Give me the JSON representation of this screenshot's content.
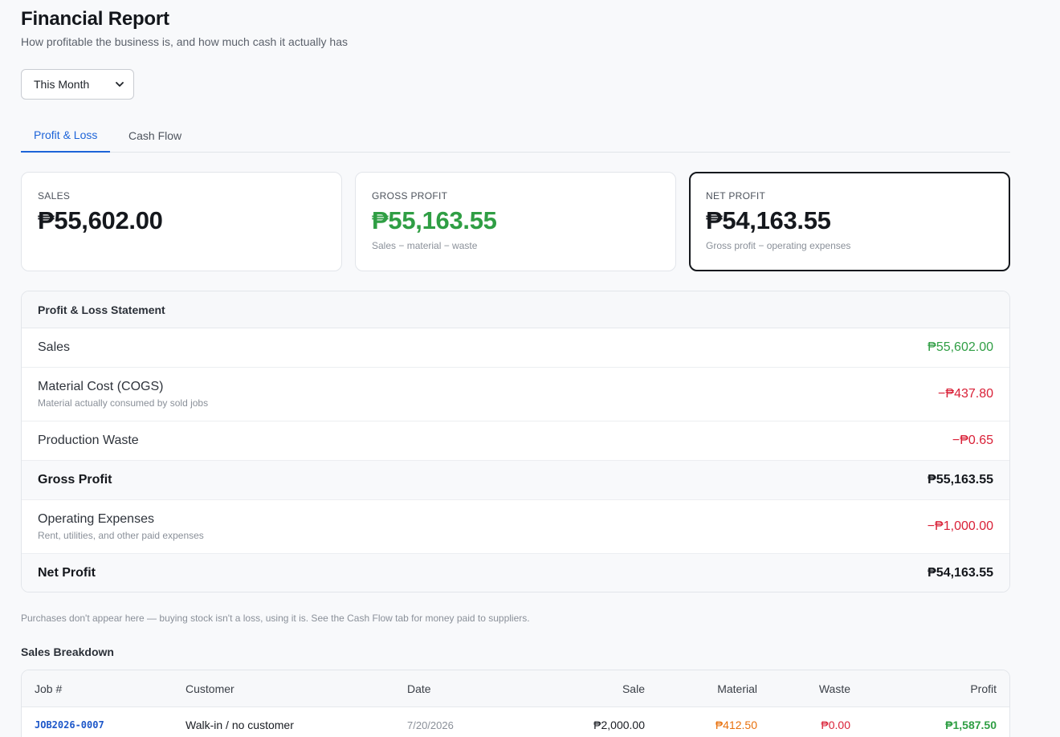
{
  "header": {
    "title": "Financial Report",
    "subtitle": "How profitable the business is, and how much cash it actually has"
  },
  "period_select": {
    "value": "This Month",
    "icon": "chevron-down-icon"
  },
  "tabs": [
    {
      "label": "Profit & Loss",
      "active": true
    },
    {
      "label": "Cash Flow",
      "active": false
    }
  ],
  "summary_cards": {
    "sales": {
      "label": "SALES",
      "value": "₱55,602.00"
    },
    "gross_profit": {
      "label": "GROSS PROFIT",
      "value": "₱55,163.55",
      "sub": "Sales − material − waste"
    },
    "net_profit": {
      "label": "NET PROFIT",
      "value": "₱54,163.55",
      "sub": "Gross profit − operating expenses"
    }
  },
  "statement": {
    "title": "Profit & Loss Statement",
    "rows": [
      {
        "label": "Sales",
        "amount": "₱55,602.00"
      },
      {
        "label": "Material Cost (COGS)",
        "note": "Material actually consumed by sold jobs",
        "amount": "−₱437.80"
      },
      {
        "label": "Production Waste",
        "amount": "−₱0.65"
      },
      {
        "label": "Gross Profit",
        "amount": "₱55,163.55"
      },
      {
        "label": "Operating Expenses",
        "note": "Rent, utilities, and other paid expenses",
        "amount": "−₱1,000.00"
      },
      {
        "label": "Net Profit",
        "amount": "₱54,163.55"
      }
    ]
  },
  "footnote": "Purchases don't appear here — buying stock isn't a loss, using it is. See the Cash Flow tab for money paid to suppliers.",
  "sales_breakdown": {
    "title": "Sales Breakdown",
    "columns": [
      "Job #",
      "Customer",
      "Date",
      "Sale",
      "Material",
      "Waste",
      "Profit"
    ],
    "rows": [
      {
        "job": "JOB2026-0007",
        "customer": "Walk-in / no customer",
        "date": "7/20/2026",
        "sale": "₱2,000.00",
        "material": "₱412.50",
        "waste": "₱0.00",
        "profit": "₱1,587.50"
      }
    ]
  },
  "colors": {
    "accent": "#1d64d8",
    "positive": "#2f9e44",
    "negative": "#d92037",
    "material": "#e8700c"
  }
}
